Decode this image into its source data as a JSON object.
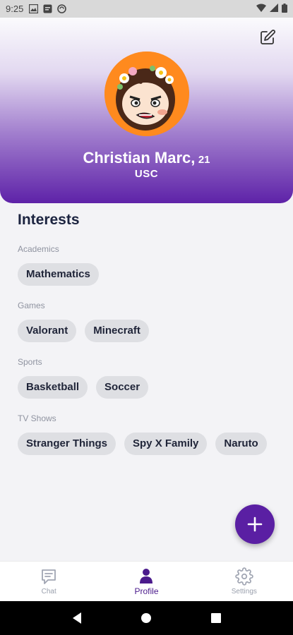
{
  "status_bar": {
    "time": "9:25"
  },
  "profile": {
    "name": "Christian Marc,",
    "age": "21",
    "school": "USC"
  },
  "interests": {
    "title": "Interests",
    "categories": [
      {
        "label": "Academics",
        "items": [
          "Mathematics"
        ]
      },
      {
        "label": "Games",
        "items": [
          "Valorant",
          "Minecraft"
        ]
      },
      {
        "label": "Sports",
        "items": [
          "Basketball",
          "Soccer"
        ]
      },
      {
        "label": "TV Shows",
        "items": [
          "Stranger Things",
          "Spy X Family",
          "Naruto"
        ]
      }
    ]
  },
  "bottom_nav": {
    "items": [
      {
        "label": "Chat",
        "icon": "chat-icon"
      },
      {
        "label": "Profile",
        "icon": "profile-icon"
      },
      {
        "label": "Settings",
        "icon": "gear-icon"
      }
    ],
    "active": "Profile"
  },
  "colors": {
    "accent": "#5a1fa3",
    "header_bottom": "#5e22a8",
    "avatar_bg": "#ff8a1e"
  }
}
